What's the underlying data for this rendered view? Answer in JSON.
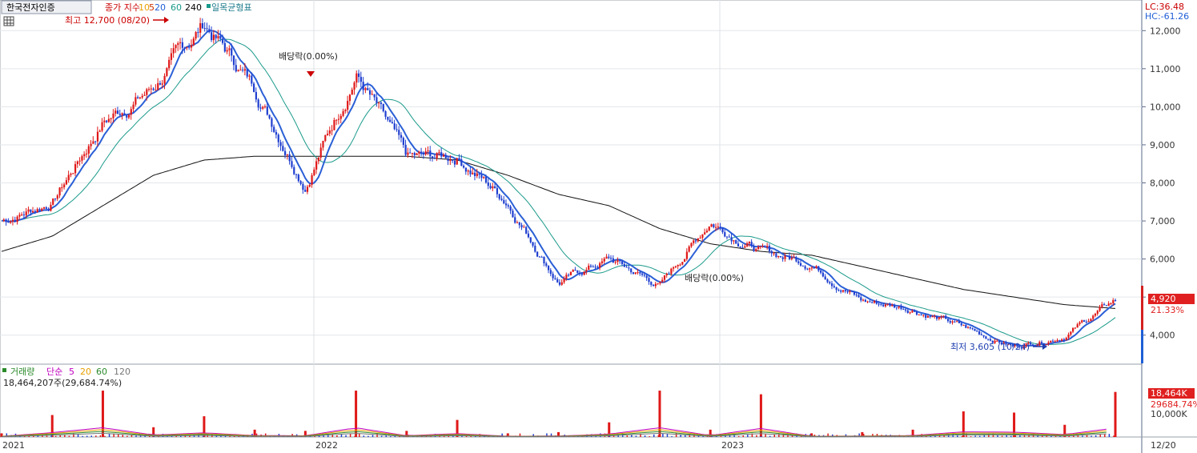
{
  "price_panel": {
    "stock_name": "한국전자인증",
    "legend_label": "종가 지수",
    "ma_periods": [
      "5",
      "10",
      "20",
      "60",
      "240"
    ],
    "ma_colors": [
      "#cc3300",
      "#e8a000",
      "#1f5fd6",
      "#1a9a8a",
      "#000000"
    ],
    "ichimoku_label": "일목균형표",
    "lc_label": "LC:36.48",
    "hc_label": "HC:-61.26",
    "high_annotation": "최고 12,700 (08/20)",
    "low_annotation": "최저 3,605 (10/24)",
    "dividend_label_1": "배당락(0.00%)",
    "dividend_label_2": "배당락(0.00%)",
    "current_price": "4,920",
    "current_change": "21.33%"
  },
  "volume_panel": {
    "title": "거래량",
    "ma_label": "단순",
    "ma_periods": [
      "5",
      "20",
      "60",
      "120"
    ],
    "ma_colors": [
      "#c000c0",
      "#e8a000",
      "#2a8a2a",
      "#777777"
    ],
    "summary": "18,464,207주(29,684.74%)",
    "current_volume": "18,464K",
    "current_ratio": "29684.74%"
  },
  "x_axis": {
    "labels": [
      "2021",
      "2022",
      "2023",
      "12/20"
    ]
  },
  "chart_data": [
    {
      "type": "line",
      "title": "한국전자인증",
      "ylim": [
        3300,
        12700
      ],
      "y_ticks": [
        "12,000",
        "11,000",
        "10,000",
        "9,000",
        "8,000",
        "7,000",
        "6,000",
        "5,000",
        "4,000"
      ],
      "x": [
        "2021-01",
        "2021-03",
        "2021-05",
        "2021-07",
        "2021-08",
        "2021-09",
        "2021-11",
        "2021-12",
        "2022-01",
        "2022-03",
        "2022-05",
        "2022-07",
        "2022-09",
        "2022-11",
        "2022-12",
        "2023-01",
        "2023-03",
        "2023-05",
        "2023-07",
        "2023-09",
        "2023-10",
        "2023-11",
        "2023-12"
      ],
      "series": [
        {
          "name": "종가",
          "values": [
            7000,
            7500,
            9600,
            10500,
            12200,
            10500,
            8000,
            10900,
            8600,
            8700,
            7500,
            5400,
            6000,
            5300,
            7000,
            6200,
            5900,
            4900,
            4700,
            4200,
            3700,
            4000,
            4920
          ]
        },
        {
          "name": "240",
          "values": [
            6200,
            6600,
            7400,
            8200,
            8600,
            8700,
            8700,
            8700,
            8700,
            8600,
            8200,
            7700,
            7400,
            6800,
            6400,
            6200,
            6100,
            5800,
            5500,
            5200,
            5000,
            4800,
            4700
          ]
        }
      ]
    },
    {
      "type": "bar",
      "title": "거래량",
      "unit": "K",
      "y_ticks": [
        "10,000K"
      ],
      "x": [
        "2021-01",
        "2021-03",
        "2021-05",
        "2021-07",
        "2021-08",
        "2021-09",
        "2021-11",
        "2021-12",
        "2022-01",
        "2022-03",
        "2022-05",
        "2022-07",
        "2022-09",
        "2022-11",
        "2022-12",
        "2023-01",
        "2023-03",
        "2023-05",
        "2023-07",
        "2023-09",
        "2023-10",
        "2023-11",
        "2023-12"
      ],
      "values": [
        1500,
        9000,
        19000,
        4000,
        8500,
        3000,
        2500,
        19000,
        2500,
        7000,
        1500,
        2000,
        6000,
        19000,
        3000,
        17500,
        1500,
        2000,
        3000,
        10500,
        10000,
        5000,
        18464
      ]
    }
  ]
}
